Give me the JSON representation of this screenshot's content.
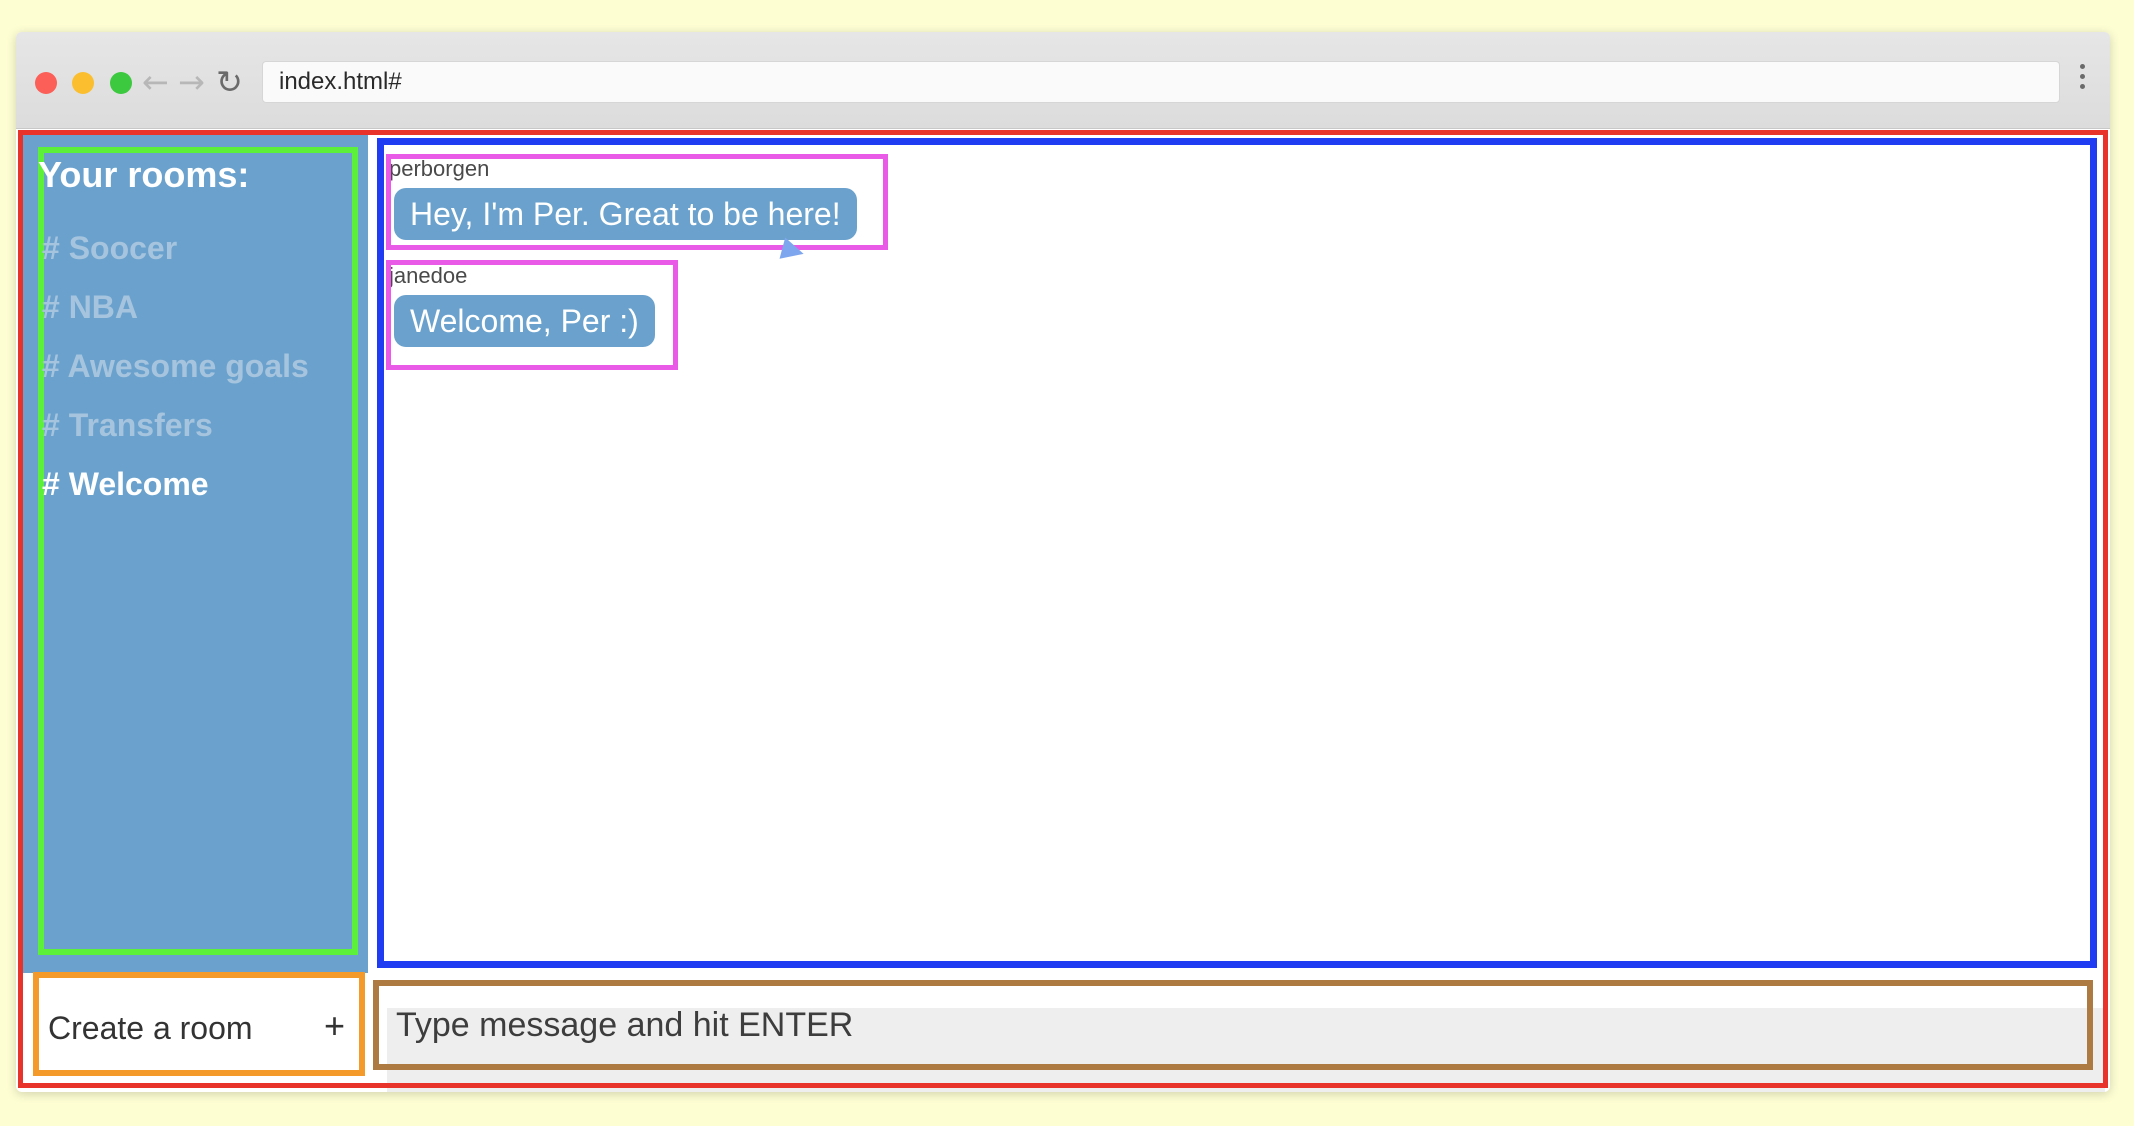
{
  "browser": {
    "url": "index.html#",
    "controls": {
      "close_color": "#fb5f57",
      "minimize_color": "#fbbe2e",
      "maximize_color": "#3cc83f"
    }
  },
  "sidebar": {
    "title": "Your rooms:",
    "background_color": "#6aa2cd",
    "rooms": [
      {
        "label": "# Soocer",
        "active": false
      },
      {
        "label": "# NBA",
        "active": false
      },
      {
        "label": "# Awesome goals",
        "active": false
      },
      {
        "label": "# Transfers",
        "active": false
      },
      {
        "label": "# Welcome",
        "active": true
      }
    ]
  },
  "messages": [
    {
      "username": "perborgen",
      "text": "Hey, I'm Per. Great to be here!"
    },
    {
      "username": "janedoe",
      "text": "Welcome, Per :)"
    }
  ],
  "new_room_form": {
    "placeholder": "Create a room",
    "submit_label": "+"
  },
  "send_message_form": {
    "placeholder": "Type message and hit ENTER"
  },
  "annotation_colors": {
    "app": "#e8332a",
    "room_list": "#5cf03a",
    "message_list": "#1f3cf2",
    "message": "#e95be6",
    "new_room_form": "#f39a2a",
    "send_message_form": "#ad7a42"
  }
}
